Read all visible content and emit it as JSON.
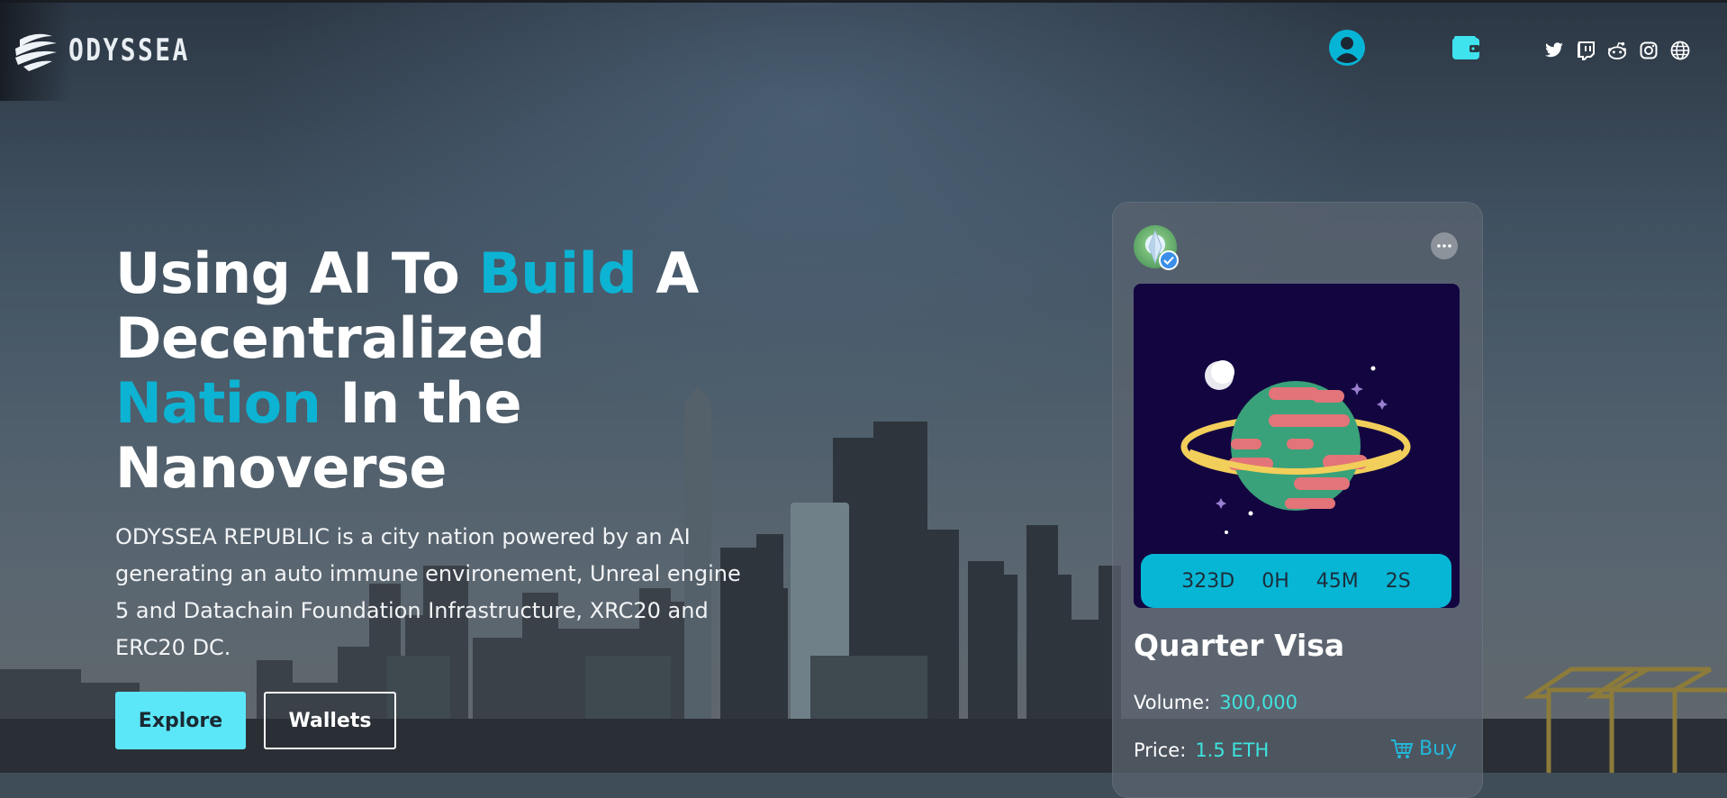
{
  "brand": {
    "name": "ODYSSEA"
  },
  "header": {
    "icons": [
      "user-account-icon",
      "wallet-icon"
    ],
    "social": [
      "twitter-icon",
      "twitch-icon",
      "reddit-icon",
      "instagram-icon",
      "globe-icon"
    ],
    "accent_color": "#0db3d3"
  },
  "hero": {
    "title_parts": {
      "p1": "Using AI To ",
      "accent1": "Build",
      "p2": " A Decentralized ",
      "accent2": "Nation",
      "p3": " In the Nanoverse"
    },
    "description": "ODYSSEA REPUBLIC is a city nation powered by an AI generating an auto immune environement, Unreal engine 5 and Datachain Foundation Infrastructure, XRC20 and ERC20 DC.",
    "buttons": {
      "explore": "Explore",
      "wallets": "Wallets"
    },
    "button_color": "#5ce7f8"
  },
  "card": {
    "timer": {
      "days": "323D",
      "hours": "0H",
      "minutes": "45M",
      "seconds": "2S"
    },
    "title": "Quarter Visa",
    "volume_label": "Volume:",
    "volume_value": "300,000",
    "price_label": "Price:",
    "price_value": "1.5 ETH",
    "buy_label": "Buy",
    "timer_color": "#07b6d5",
    "value_color": "#3fe3de"
  }
}
